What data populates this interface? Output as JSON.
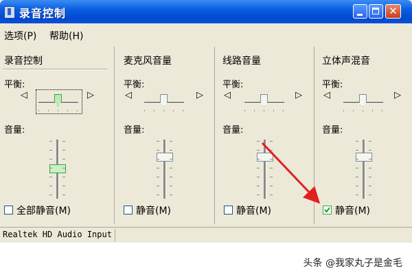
{
  "window": {
    "title": "录音控制",
    "status_text": "Realtek HD Audio Input"
  },
  "menu": [
    {
      "label": "选项(P)"
    },
    {
      "label": "帮助(H)"
    }
  ],
  "panels": [
    {
      "title": "录音控制",
      "balance_label": "平衡:",
      "volume_label": "音量:",
      "mute_label": "全部静音(M)",
      "mute_checked": false
    },
    {
      "title": "麦克风音量",
      "balance_label": "平衡:",
      "volume_label": "音量:",
      "mute_label": "静音(M)",
      "mute_checked": false
    },
    {
      "title": "线路音量",
      "balance_label": "平衡:",
      "volume_label": "音量:",
      "mute_label": "静音(M)",
      "mute_checked": false
    },
    {
      "title": "立体声混音",
      "balance_label": "平衡:",
      "volume_label": "音量:",
      "mute_label": "静音(M)",
      "mute_checked": true
    }
  ],
  "watermark": "头条 @我家丸子是金毛",
  "colors": {
    "titlebar": "#0a5ee0",
    "annotation_arrow": "#e02020",
    "active_thumb": "#3aa34a"
  },
  "icons": {
    "speaker_left": "speaker-left-icon",
    "speaker_right": "speaker-right-icon"
  }
}
